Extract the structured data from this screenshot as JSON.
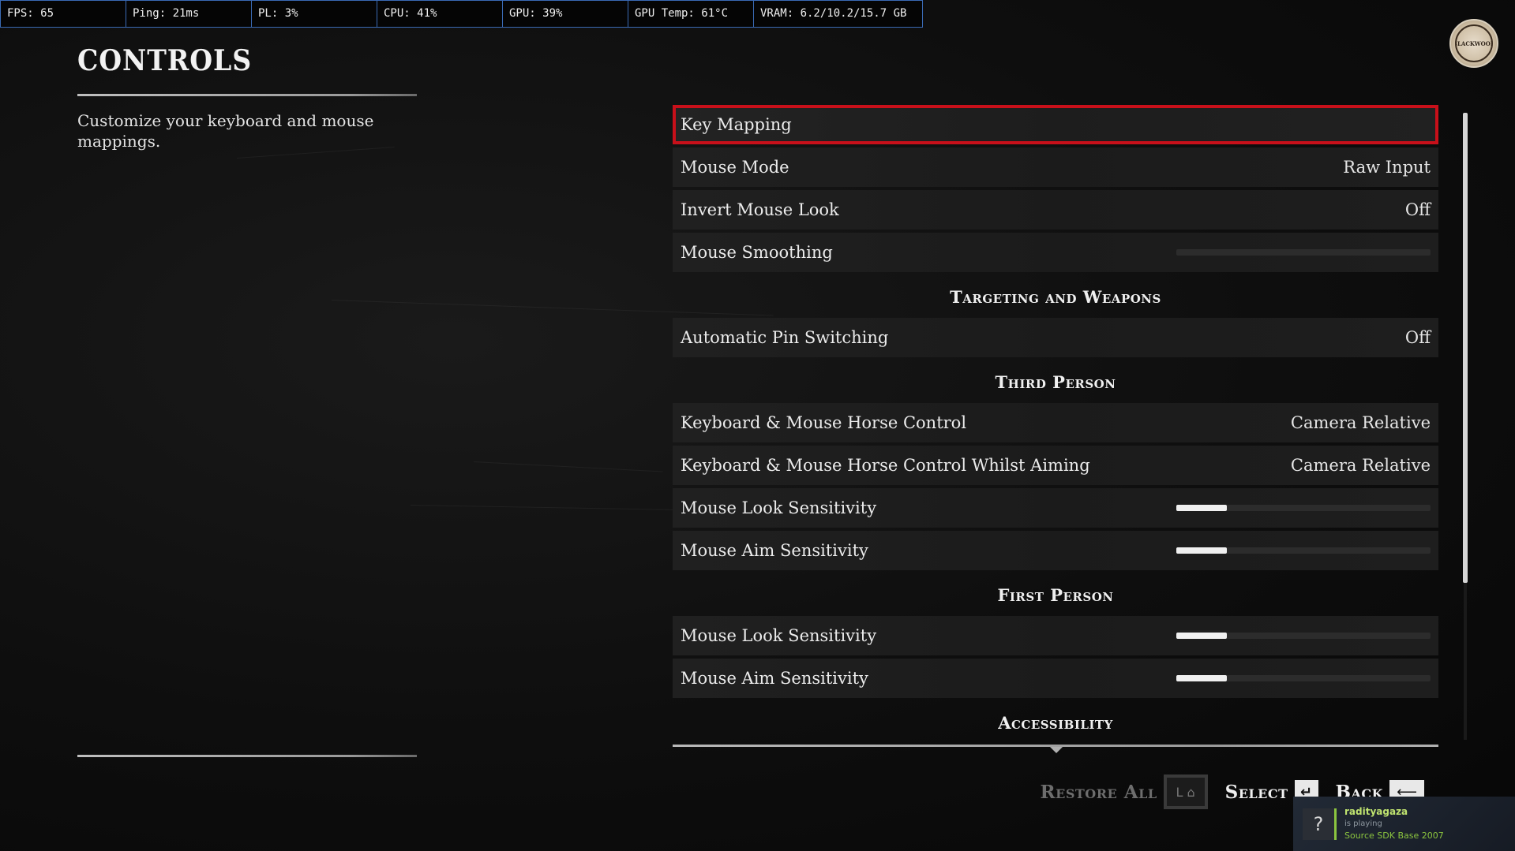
{
  "perf_overlay": [
    {
      "label": "FPS: 65"
    },
    {
      "label": "Ping: 21ms"
    },
    {
      "label": "PL: 3%"
    },
    {
      "label": "CPU: 41%"
    },
    {
      "label": "GPU: 39%"
    },
    {
      "label": "GPU Temp: 61°C"
    },
    {
      "label": "VRAM: 6.2/10.2/15.7 GB"
    }
  ],
  "header": {
    "title": "CONTROLS",
    "description": "Customize your keyboard and mouse mappings."
  },
  "logo": {
    "text": "BLACKWOOD"
  },
  "settings": [
    {
      "kind": "row",
      "label": "Key Mapping",
      "value": "",
      "selected": true
    },
    {
      "kind": "row",
      "label": "Mouse Mode",
      "value": "Raw Input"
    },
    {
      "kind": "row",
      "label": "Invert Mouse Look",
      "value": "Off"
    },
    {
      "kind": "slider",
      "label": "Mouse Smoothing",
      "level": 0
    },
    {
      "kind": "section",
      "label": "Targeting and Weapons"
    },
    {
      "kind": "row",
      "label": "Automatic Pin Switching",
      "value": "Off"
    },
    {
      "kind": "section",
      "label": "Third Person"
    },
    {
      "kind": "row",
      "label": "Keyboard & Mouse Horse Control",
      "value": "Camera Relative"
    },
    {
      "kind": "row",
      "label": "Keyboard & Mouse Horse Control Whilst Aiming",
      "value": "Camera Relative"
    },
    {
      "kind": "slider",
      "label": "Mouse Look Sensitivity",
      "level": 0.2
    },
    {
      "kind": "slider",
      "label": "Mouse Aim Sensitivity",
      "level": 0.2
    },
    {
      "kind": "section",
      "label": "First Person"
    },
    {
      "kind": "slider",
      "label": "Mouse Look Sensitivity",
      "level": 0.2
    },
    {
      "kind": "slider",
      "label": "Mouse Aim Sensitivity",
      "level": 0.2
    },
    {
      "kind": "section",
      "label": "Accessibility"
    }
  ],
  "scrollbar": {
    "position": 0.0,
    "visible_fraction": 0.75
  },
  "actions": [
    {
      "label": "Restore All",
      "key": "L ⌂",
      "disabled": true,
      "name": "restore-all"
    },
    {
      "label": "Select",
      "key": "↵",
      "disabled": false,
      "name": "select"
    },
    {
      "label": "Back",
      "key": "⟵",
      "disabled": false,
      "name": "back"
    }
  ],
  "steam": {
    "avatar": "?",
    "user": "radityagaza",
    "status": "is playing",
    "game": "Source SDK Base 2007"
  },
  "colors": {
    "selection": "#c8101a",
    "overlay_border": "#3a6ab4",
    "steam_green": "#8bc53f"
  }
}
